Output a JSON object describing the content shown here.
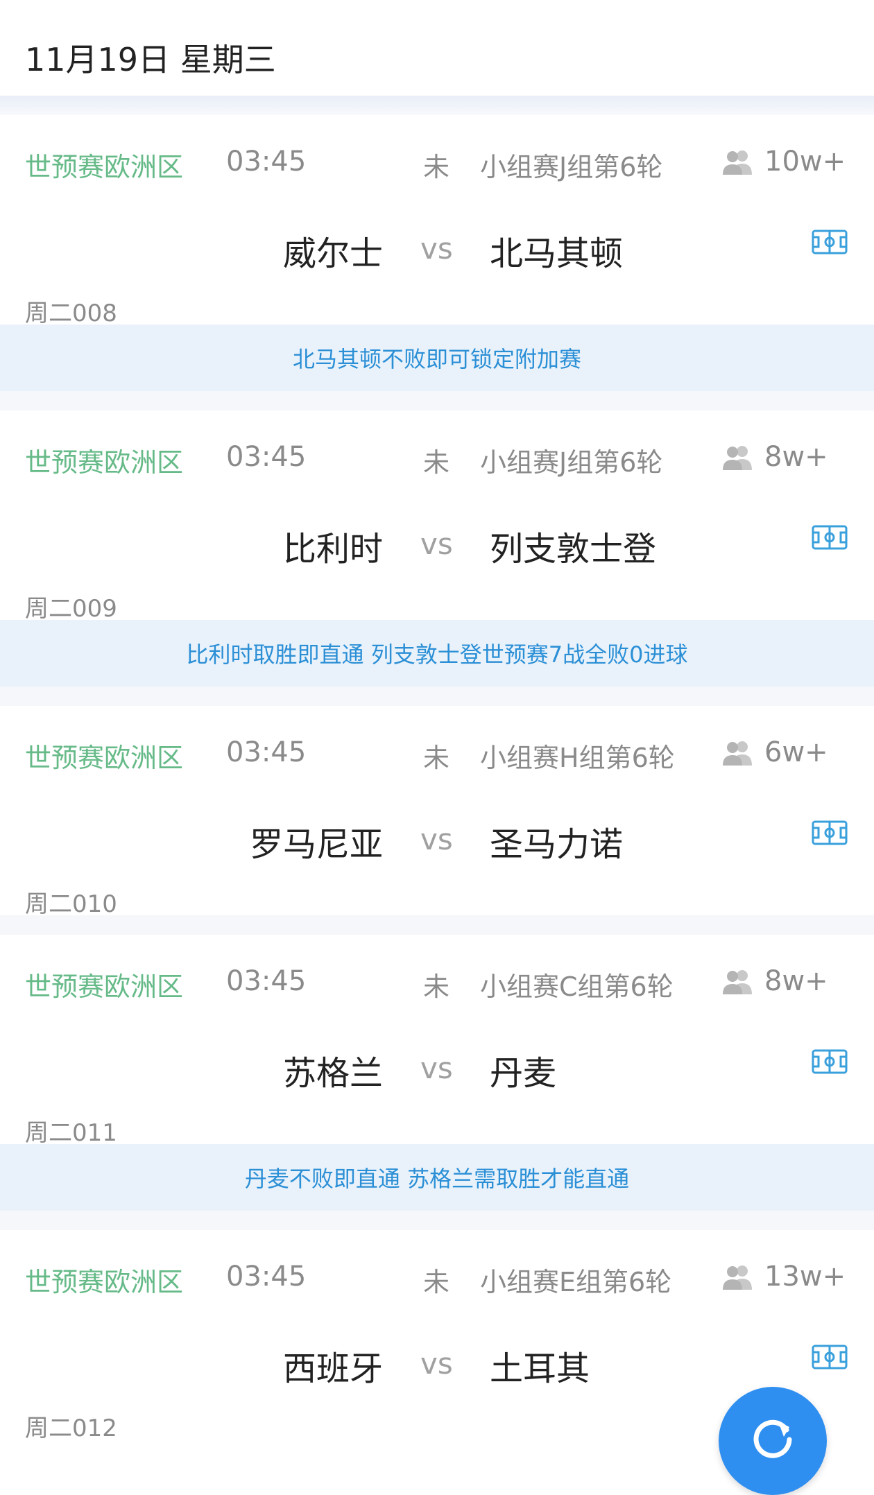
{
  "header": {
    "date": "11月19日 星期三"
  },
  "matches": [
    {
      "league": "世预赛欧洲区",
      "time": "03:45",
      "status": "未",
      "round": "小组赛J组第6轮",
      "viewers": "10w+",
      "home": "威尔士",
      "vs": "vs",
      "away": "北马其顿",
      "code": "周二008",
      "notice": "北马其顿不败即可锁定附加赛"
    },
    {
      "league": "世预赛欧洲区",
      "time": "03:45",
      "status": "未",
      "round": "小组赛J组第6轮",
      "viewers": "8w+",
      "home": "比利时",
      "vs": "vs",
      "away": "列支敦士登",
      "code": "周二009",
      "notice": "比利时取胜即直通 列支敦士登世预赛7战全败0进球"
    },
    {
      "league": "世预赛欧洲区",
      "time": "03:45",
      "status": "未",
      "round": "小组赛H组第6轮",
      "viewers": "6w+",
      "home": "罗马尼亚",
      "vs": "vs",
      "away": "圣马力诺",
      "code": "周二010"
    },
    {
      "league": "世预赛欧洲区",
      "time": "03:45",
      "status": "未",
      "round": "小组赛C组第6轮",
      "viewers": "8w+",
      "home": "苏格兰",
      "vs": "vs",
      "away": "丹麦",
      "code": "周二011",
      "notice": "丹麦不败即直通 苏格兰需取胜才能直通"
    },
    {
      "league": "世预赛欧洲区",
      "time": "03:45",
      "status": "未",
      "round": "小组赛E组第6轮",
      "viewers": "13w+",
      "home": "西班牙",
      "vs": "vs",
      "away": "土耳其",
      "code": "周二012"
    }
  ],
  "icons": {
    "people": "people-icon",
    "field": "field-icon",
    "refresh": "refresh-icon"
  },
  "colors": {
    "league": "#66ba88",
    "notice_text": "#2b8fd6",
    "notice_bg": "#e9f2fb",
    "fab": "#2f8ff0"
  }
}
